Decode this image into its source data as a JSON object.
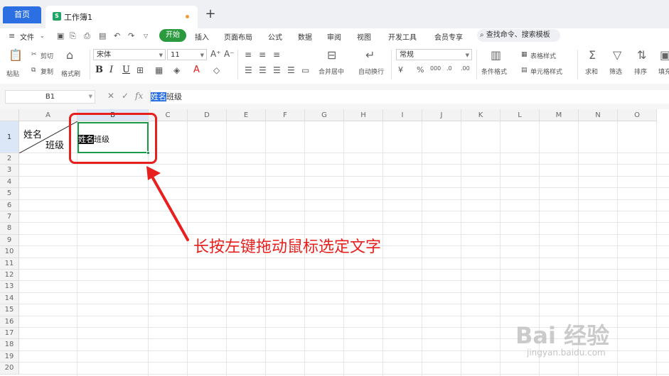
{
  "tabs": {
    "home_label": "首页",
    "doc_label": "工作簿1",
    "add_label": "+"
  },
  "menubar": {
    "file_label": "文件",
    "items": [
      "开始",
      "插入",
      "页面布局",
      "公式",
      "数据",
      "审阅",
      "视图",
      "开发工具",
      "会员专享"
    ],
    "search_placeholder": "查找命令、搜索模板"
  },
  "ribbon": {
    "paste_label": "粘贴",
    "cut_label": "剪切",
    "copy_label": "复制",
    "format_painter_label": "格式刷",
    "font_name": "宋体",
    "font_size": "11",
    "merge_label": "合并居中",
    "wrap_label": "自动换行",
    "number_format": "常规",
    "cond_format_label": "条件格式",
    "table_style_label": "表格样式",
    "cell_style_label": "单元格样式",
    "sum_label": "求和",
    "filter_label": "筛选",
    "sort_label": "排序",
    "fill_label": "填充"
  },
  "formula_bar": {
    "name_box": "B1",
    "fx_label": "fx",
    "content_selected": "姓名",
    "content_rest": "班级"
  },
  "sheet": {
    "columns": [
      "A",
      "B",
      "C",
      "D",
      "E",
      "F",
      "G",
      "H",
      "I",
      "J",
      "K",
      "L",
      "M",
      "N",
      "O"
    ],
    "rows": [
      "1",
      "2",
      "3",
      "4",
      "5",
      "6",
      "7",
      "8",
      "9",
      "10",
      "11",
      "12",
      "13",
      "14",
      "15",
      "16",
      "17",
      "18",
      "19",
      "20"
    ],
    "active_cell": "B1",
    "a1_top": "姓名",
    "a1_bottom": "班级",
    "b1_selected": "姓名",
    "b1_rest": "班级"
  },
  "annotation": {
    "text": "长按左键拖动鼠标选定文字",
    "color": "#e7201e"
  },
  "watermark": {
    "logo": "Bai 经验",
    "url": "jingyan.baidu.com"
  },
  "colors": {
    "accent_blue": "#2b6fe3",
    "start_green": "#2b9a3e",
    "cell_border_green": "#1a9a48"
  }
}
